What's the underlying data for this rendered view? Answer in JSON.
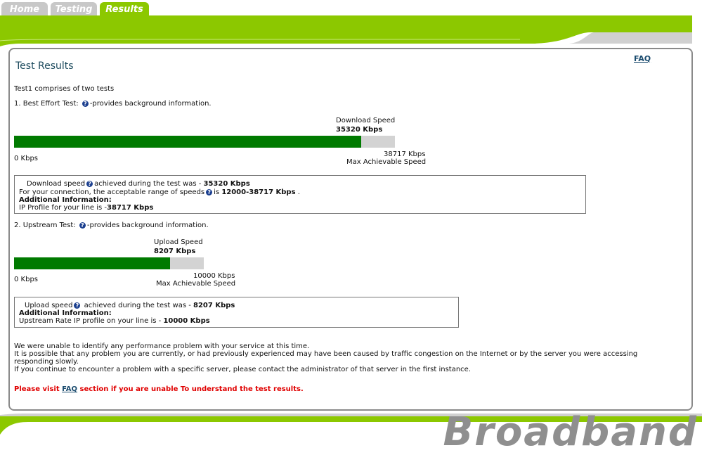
{
  "tabs": [
    {
      "label": "Home"
    },
    {
      "label": "Testing"
    },
    {
      "label": "Results"
    }
  ],
  "faq_link": "FAQ",
  "page_title": "Test Results",
  "intro": "Test1 comprises of two tests",
  "test1": {
    "heading": "1. Best Effort Test:",
    "heading_suffix": "-provides background information.",
    "speed_label": "Download Speed",
    "speed_value": "35320 Kbps",
    "min_label": "0 Kbps",
    "max_value": "38717 Kbps",
    "max_label": "Max Achievable Speed",
    "progress_fraction": 0.912,
    "box": {
      "line1_pre": "Download speed",
      "line1_mid": "achieved during the test was - ",
      "line1_value": "35320 Kbps",
      "line2_pre": "For your connection, the acceptable range of speeds",
      "line2_mid": "is ",
      "line2_value": "12000-38717 Kbps",
      "line2_post": " .",
      "line3": "Additional Information:",
      "line4_pre": "IP Profile for your line is -",
      "line4_value": "38717 Kbps"
    }
  },
  "test2": {
    "heading": "2. Upstream Test:",
    "heading_suffix": "-provides background information.",
    "speed_label": "Upload Speed",
    "speed_value": "8207 Kbps",
    "min_label": "0 Kbps",
    "max_value": "10000 Kbps",
    "max_label": "Max Achievable Speed",
    "progress_fraction": 0.8207,
    "box": {
      "line1_pre": "Upload speed",
      "line1_mid": " achieved during the test was - ",
      "line1_value": "8207 Kbps",
      "line2": "Additional Information:",
      "line3_pre": "Upstream Rate IP profile on your line is - ",
      "line3_value": "10000 Kbps"
    }
  },
  "summary": {
    "line1": "We were unable to identify any performance problem with your service at this time.",
    "line2": "It is possible that any problem you are currently, or had previously experienced may have been caused by traffic congestion on the Internet or by the server you were accessing",
    "line3": "responding slowly.",
    "line4": "If you continue to encounter a problem with a specific server, please contact the administrator of that server in the first instance."
  },
  "notice": {
    "pre": "Please visit ",
    "link": "FAQ",
    "post": " section if you are unable To understand the test results."
  },
  "brand_text": "Broadband",
  "colors": {
    "accent_green": "#8cc800",
    "bar_green": "#007a00",
    "bar_grey": "#d3d3d3",
    "notice_red": "#e00000"
  }
}
